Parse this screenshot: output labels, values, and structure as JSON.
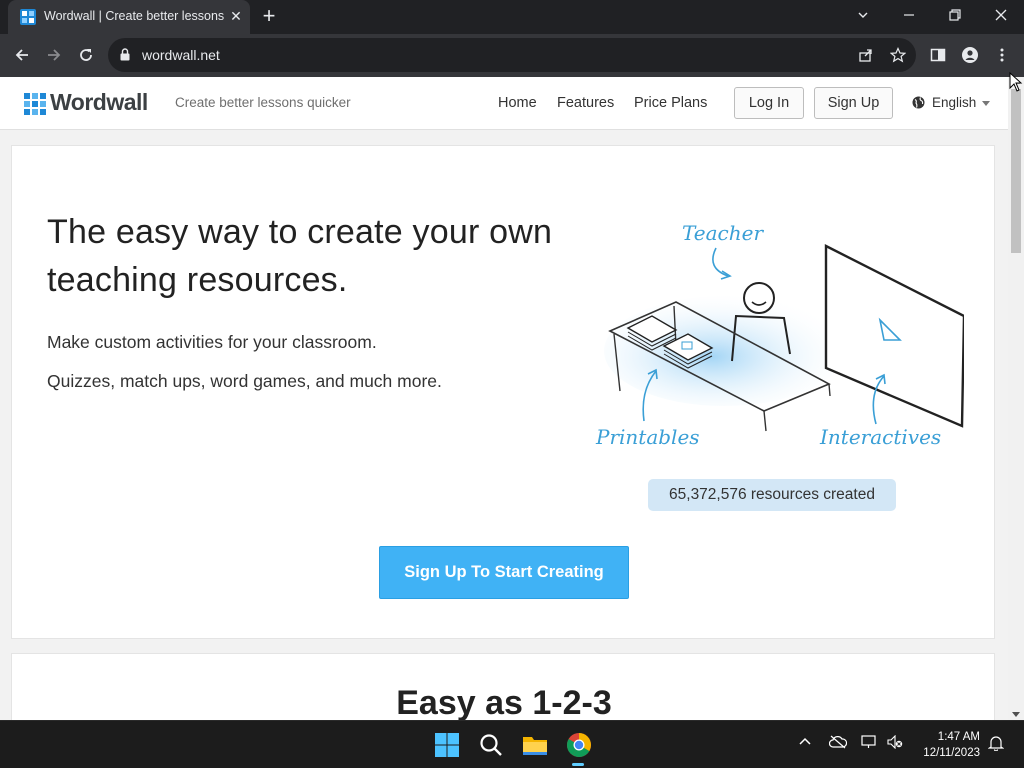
{
  "browser": {
    "tab_title": "Wordwall | Create better lessons quicker",
    "url": "wordwall.net"
  },
  "site": {
    "brand": "Wordwall",
    "tagline": "Create better lessons quicker",
    "nav": [
      "Home",
      "Features",
      "Price Plans"
    ],
    "login_label": "Log In",
    "signup_label": "Sign Up",
    "language": "English"
  },
  "hero": {
    "title": "The easy way to create your own teaching resources.",
    "subtitle_1": "Make custom activities for your classroom.",
    "subtitle_2": "Quizzes, match ups, word games, and much more.",
    "illustration_labels": {
      "teacher": "Teacher",
      "printables": "Printables",
      "interactives": "Interactives"
    },
    "counter": "65,372,576 resources created",
    "cta_label": "Sign Up To Start Creating"
  },
  "section2": {
    "title": "Easy as 1-2-3"
  },
  "taskbar": {
    "time": "1:47 AM",
    "date": "12/11/2023"
  },
  "colors": {
    "accent": "#40b2f5",
    "counter_bg": "#d3e7f6",
    "illustration_blue": "#3a9fd6"
  }
}
